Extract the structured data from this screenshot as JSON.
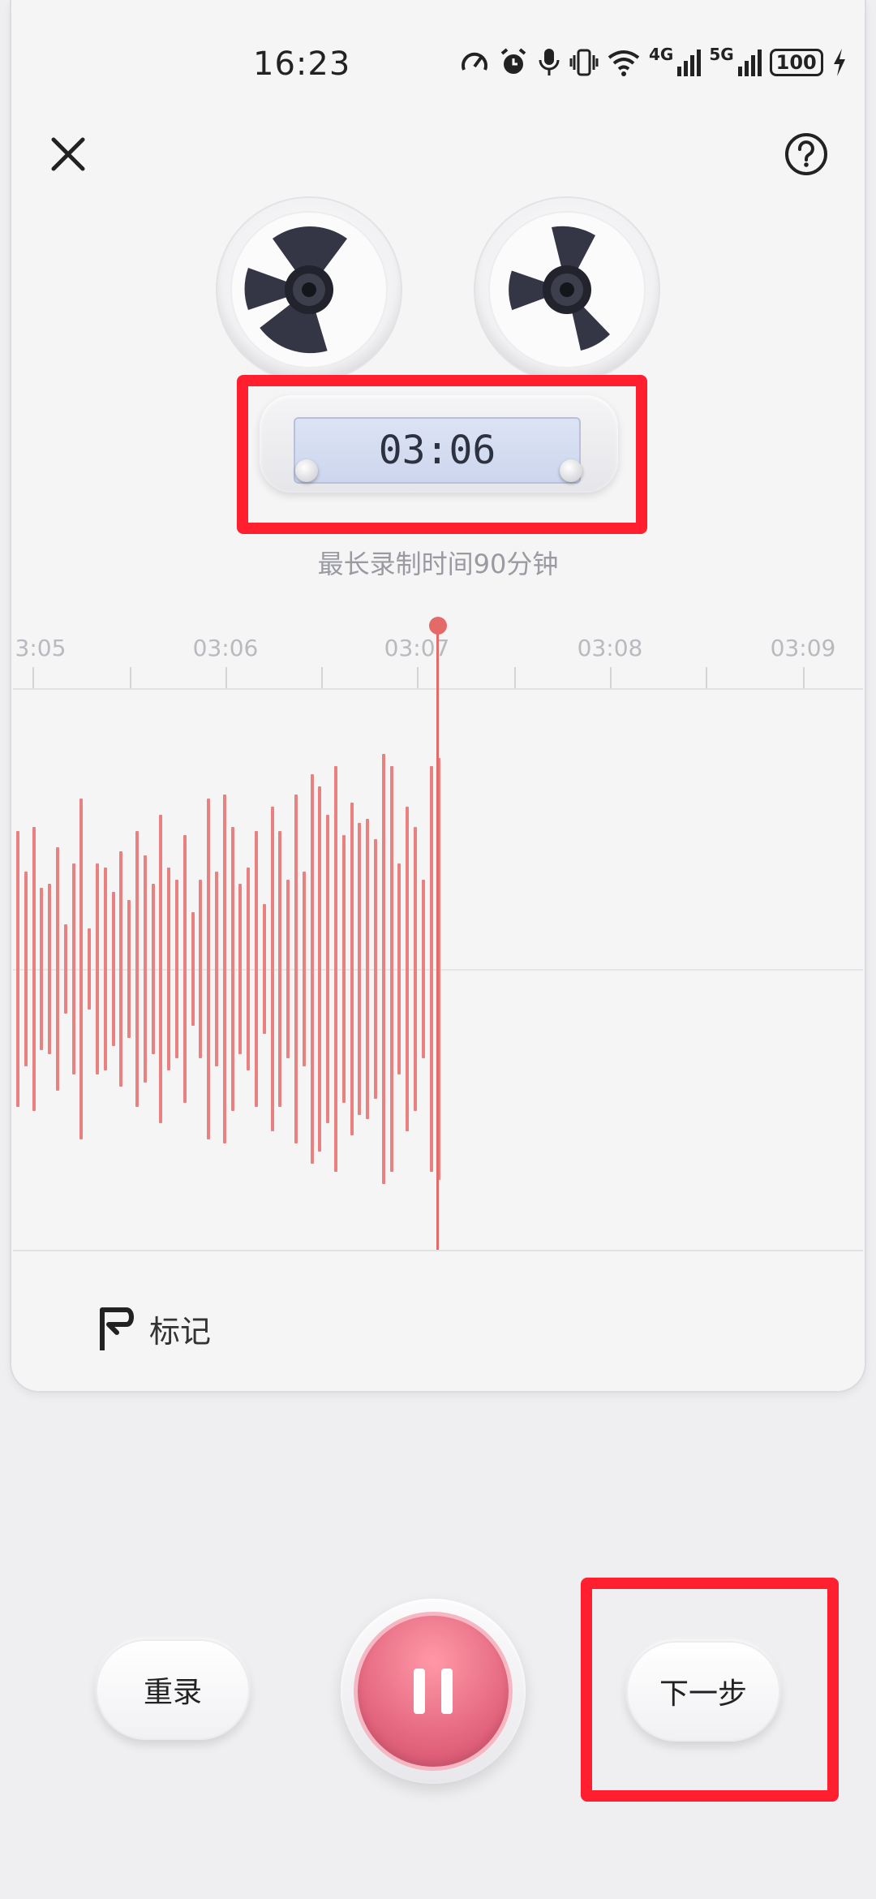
{
  "status_bar": {
    "time": "16:23",
    "net_4g": "4G",
    "net_5g": "5G",
    "battery": "100"
  },
  "recorder": {
    "timer": "03:06",
    "max_time_note": "最长录制时间90分钟"
  },
  "timeline": {
    "labels": [
      "3:05",
      "03:06",
      "03:07",
      "03:08",
      "03:09"
    ]
  },
  "actions": {
    "mark": "标记",
    "rerecord": "重录",
    "next": "下一步"
  },
  "colors": {
    "accent": "#e46a6a",
    "waveform": "#e98181",
    "highlight": "#ff1f2e"
  }
}
